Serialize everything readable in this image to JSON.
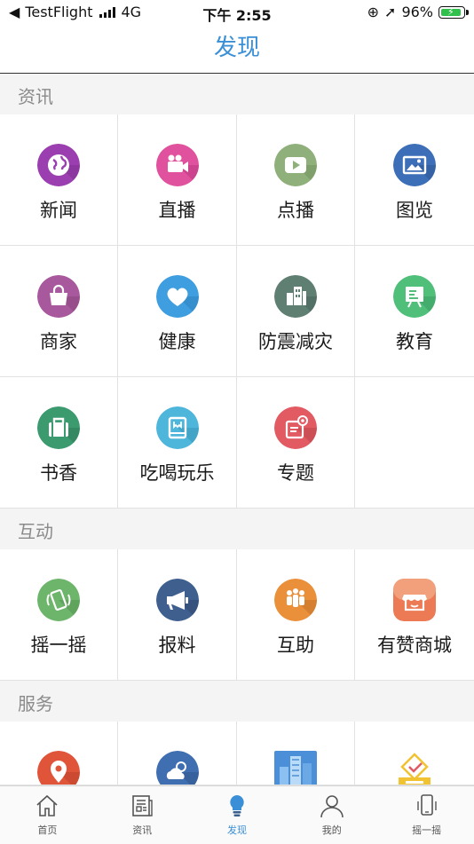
{
  "status_bar": {
    "back_app": "TestFlight",
    "network": "4G",
    "time": "下午 2:55",
    "battery": "96%"
  },
  "nav": {
    "title": "发现"
  },
  "sections": [
    {
      "title": "资讯",
      "items": [
        {
          "label": "新闻",
          "icon": "globe-icon",
          "color": "#9b3fb0"
        },
        {
          "label": "直播",
          "icon": "video-camera-icon",
          "color": "#e0519e"
        },
        {
          "label": "点播",
          "icon": "play-icon",
          "color": "#8fb07a"
        },
        {
          "label": "图览",
          "icon": "picture-icon",
          "color": "#3d6fb8"
        },
        {
          "label": "商家",
          "icon": "shopping-bag-icon",
          "color": "#a8589c"
        },
        {
          "label": "健康",
          "icon": "heart-icon",
          "color": "#3f9ee0"
        },
        {
          "label": "防震减灾",
          "icon": "buildings-icon",
          "color": "#5f7f72"
        },
        {
          "label": "教育",
          "icon": "presentation-board-icon",
          "color": "#4fbf7a"
        },
        {
          "label": "书香",
          "icon": "briefcase-icon",
          "color": "#3c9a6f"
        },
        {
          "label": "吃喝玩乐",
          "icon": "book-icon",
          "color": "#4fb6db"
        },
        {
          "label": "专题",
          "icon": "topic-card-icon",
          "color": "#e25a62"
        }
      ]
    },
    {
      "title": "互动",
      "items": [
        {
          "label": "摇一摇",
          "icon": "shake-phone-icon",
          "color": "#6db56b"
        },
        {
          "label": "报料",
          "icon": "megaphone-icon",
          "color": "#3f5f8f"
        },
        {
          "label": "互助",
          "icon": "people-group-icon",
          "color": "#ea8f3a"
        },
        {
          "label": "有赞商城",
          "icon": "store-icon",
          "color": "#ec7a55"
        }
      ]
    },
    {
      "title": "服务",
      "items": [
        {
          "label": "",
          "icon": "location-pin-icon",
          "color": "#e0553a"
        },
        {
          "label": "",
          "icon": "weather-icon",
          "color": "#3f6fb0"
        },
        {
          "label": "",
          "icon": "city-building-icon",
          "color": "#4a8fd8"
        },
        {
          "label": "",
          "icon": "ballot-box-icon",
          "color": "#f1c232"
        }
      ]
    }
  ],
  "tabbar": [
    {
      "label": "首页",
      "icon": "home-icon"
    },
    {
      "label": "资讯",
      "icon": "newspaper-icon"
    },
    {
      "label": "发现",
      "icon": "lightbulb-icon",
      "active": true
    },
    {
      "label": "我的",
      "icon": "user-icon"
    },
    {
      "label": "摇一摇",
      "icon": "phone-shake-icon"
    }
  ]
}
